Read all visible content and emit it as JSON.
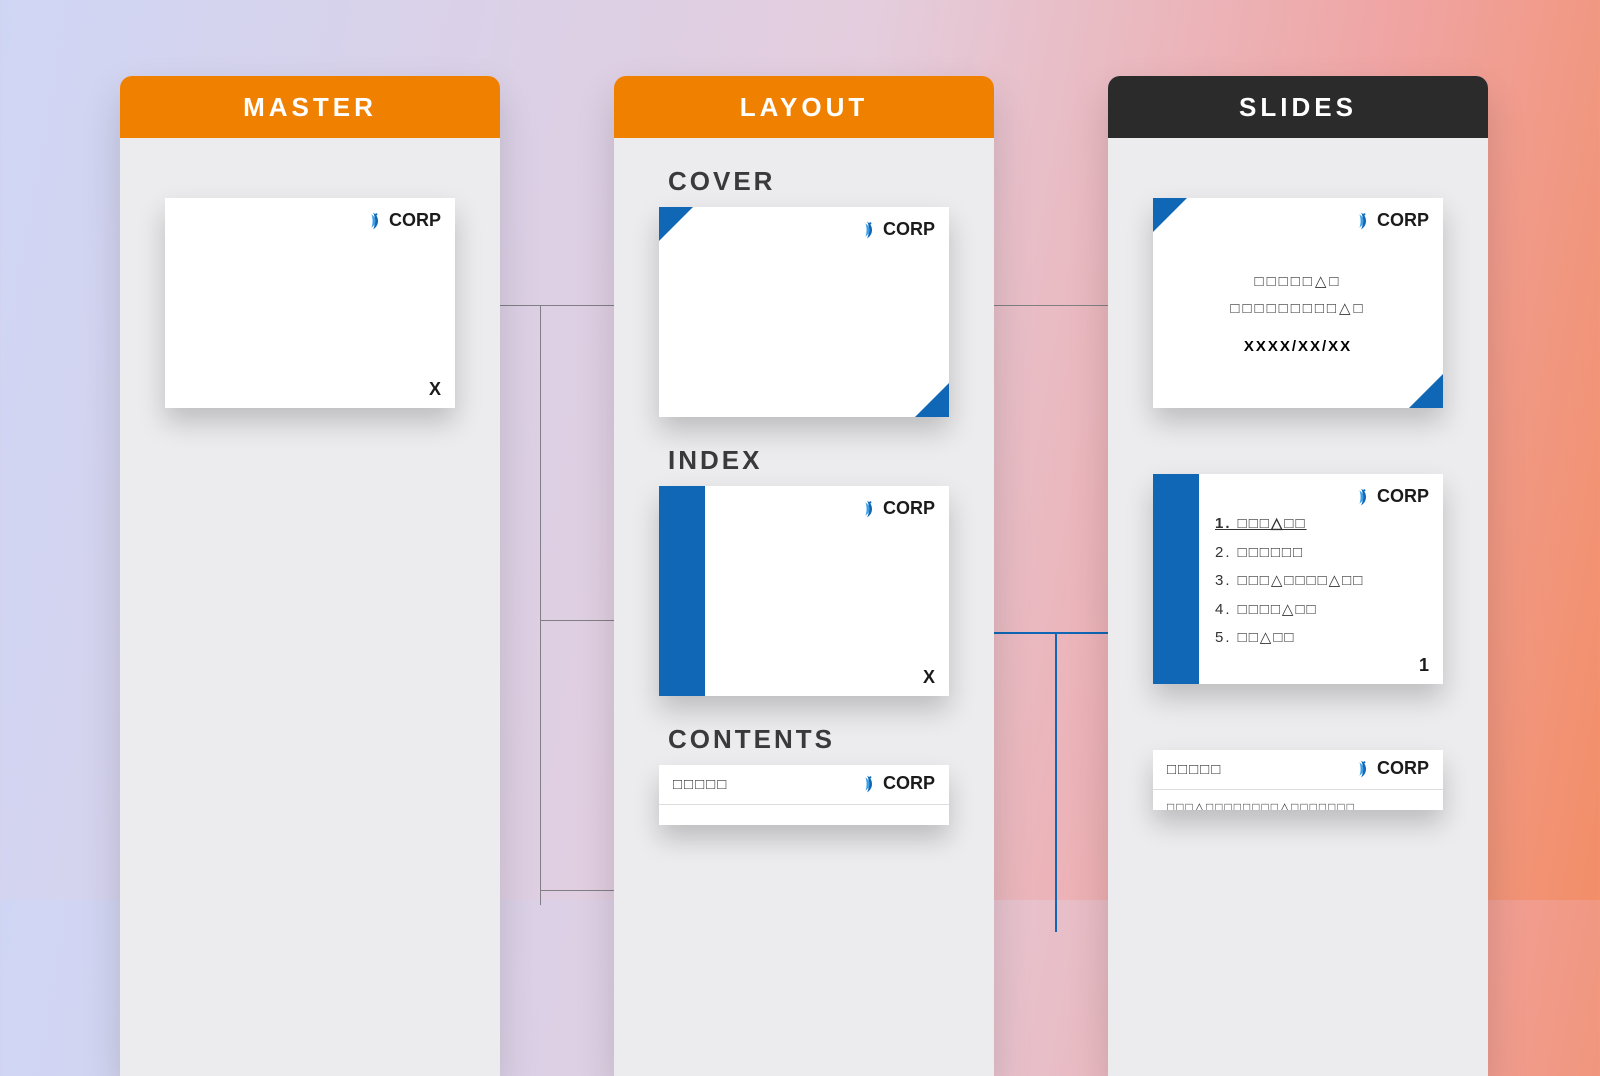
{
  "columns": {
    "master": {
      "title": "MASTER",
      "header_color": "orange"
    },
    "layout": {
      "title": "LAYOUT",
      "header_color": "orange",
      "sections": [
        "COVER",
        "INDEX",
        "CONTENTS"
      ]
    },
    "slides": {
      "title": "SLIDES",
      "header_color": "dark"
    }
  },
  "brand": {
    "name": "CORP",
    "accent": "#0f67b5"
  },
  "master_slide": {
    "page_marker": "X"
  },
  "layout_slides": {
    "cover": {
      "corners": [
        "top-left",
        "bottom-right"
      ]
    },
    "index": {
      "sidebar": true,
      "page_marker": "X"
    },
    "contents": {
      "title_placeholder": "□□□□□"
    }
  },
  "slides": {
    "cover": {
      "line1": "□□□□□△□",
      "line2": "□□□□□□□□□△□",
      "date": "XXXX/XX/XX"
    },
    "index": {
      "items": [
        "1. □□□△□□",
        "2. □□□□□□",
        "3. □□□△□□□□△□□",
        "4. □□□□△□□",
        "5. □□△□□"
      ],
      "page_number": "1"
    },
    "contents": {
      "title": "□□□□□",
      "body": "□□□△□□□□□□□□△□□□□□□□"
    }
  }
}
